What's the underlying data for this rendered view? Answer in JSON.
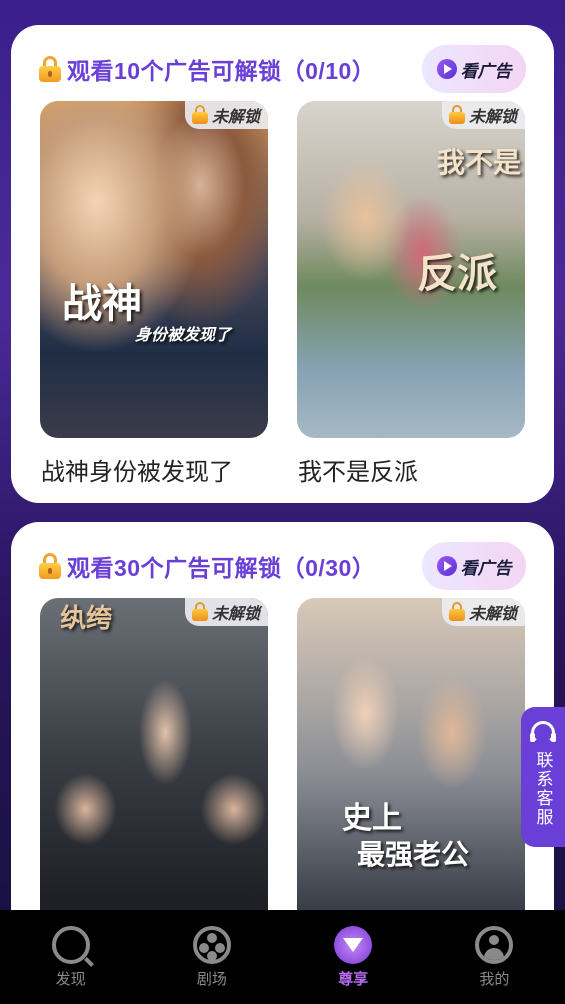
{
  "sections": [
    {
      "title": "观看10个广告可解锁（0/10）",
      "ad_button": "看广告",
      "items": [
        {
          "title": "战神身份被发现了",
          "badge": "未解锁",
          "poster_text": "战神",
          "poster_subtext": "身份被发现了"
        },
        {
          "title": "我不是反派",
          "badge": "未解锁",
          "poster_text": "反派",
          "poster_subtext": "我不是"
        }
      ]
    },
    {
      "title": "观看30个广告可解锁（0/30）",
      "ad_button": "看广告",
      "items": [
        {
          "title": "",
          "badge": "未解锁",
          "poster_text": "",
          "poster_subtext": "纨绔"
        },
        {
          "title": "",
          "badge": "未解锁",
          "poster_text": "史上",
          "poster_subtext": "最强老公"
        }
      ]
    }
  ],
  "side_service": {
    "label": "联系客服",
    "icon": "headset-icon"
  },
  "tabbar": [
    {
      "label": "发现",
      "icon": "search-icon",
      "active": false
    },
    {
      "label": "剧场",
      "icon": "film-reel-icon",
      "active": false
    },
    {
      "label": "尊享",
      "icon": "diamond-icon",
      "active": true
    },
    {
      "label": "我的",
      "icon": "user-icon",
      "active": false
    }
  ],
  "colors": {
    "accent": "#6a3fd8",
    "tab_active": "#b66cf0",
    "badge_lock": "#f1a530"
  }
}
